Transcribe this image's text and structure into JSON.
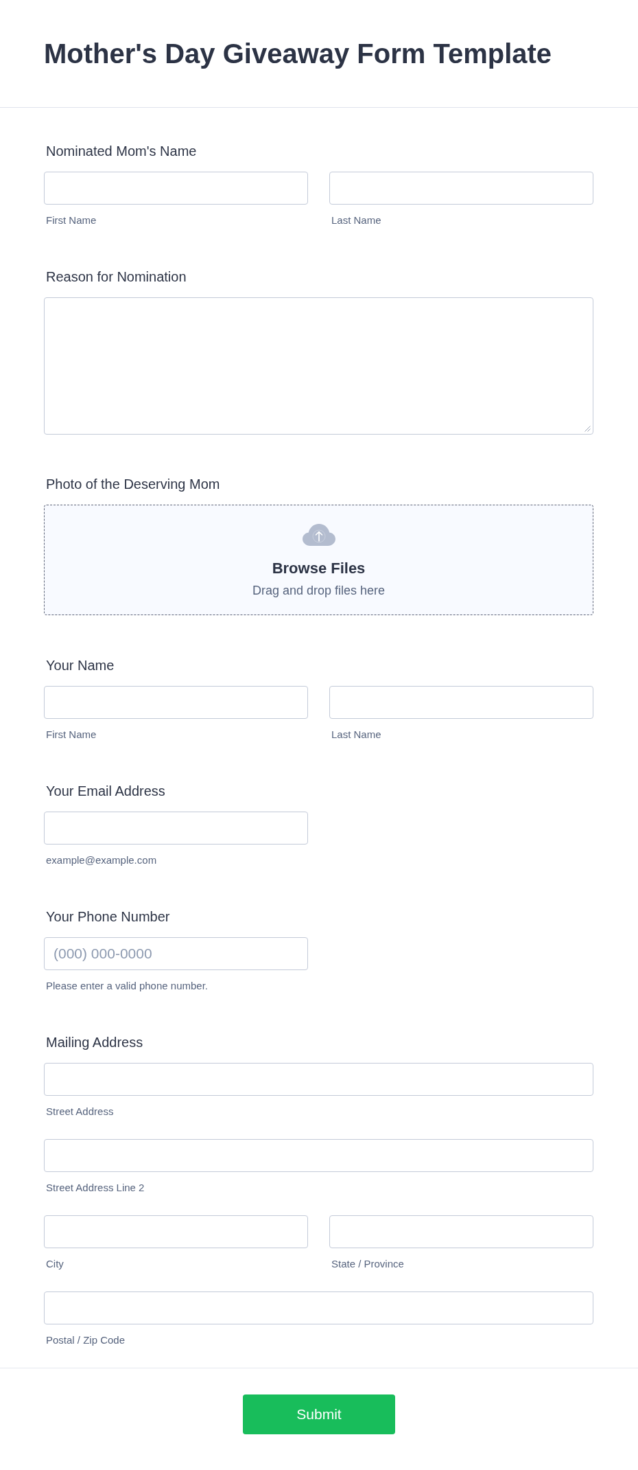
{
  "title": "Mother's Day Giveaway Form Template",
  "fields": [
    {
      "kind": "name",
      "label": "Nominated Mom's Name",
      "rows": [
        [
          {
            "sublabel": "First Name"
          },
          {
            "sublabel": "Last Name"
          }
        ]
      ]
    },
    {
      "kind": "textarea",
      "label": "Reason for Nomination"
    },
    {
      "kind": "upload",
      "label": "Photo of the Deserving Mom",
      "button": "Browse Files",
      "hint": "Drag and drop files here"
    },
    {
      "kind": "name",
      "label": "Your Name",
      "rows": [
        [
          {
            "sublabel": "First Name"
          },
          {
            "sublabel": "Last Name"
          }
        ]
      ]
    },
    {
      "kind": "email",
      "label": "Your Email Address",
      "rows": [
        [
          {
            "sublabel": "example@example.com"
          }
        ]
      ]
    },
    {
      "kind": "phone",
      "label": "Your Phone Number",
      "rows": [
        [
          {
            "placeholder": "(000) 000-0000",
            "sublabel": "Please enter a valid phone number."
          }
        ]
      ]
    },
    {
      "kind": "address",
      "label": "Mailing Address",
      "rows": [
        [
          {
            "sublabel": "Street Address"
          }
        ],
        [
          {
            "sublabel": "Street Address Line 2"
          }
        ],
        [
          {
            "sublabel": "City"
          },
          {
            "sublabel": "State / Province"
          }
        ],
        [
          {
            "sublabel": "Postal / Zip Code"
          }
        ]
      ]
    }
  ],
  "submit": {
    "label": "Submit"
  }
}
